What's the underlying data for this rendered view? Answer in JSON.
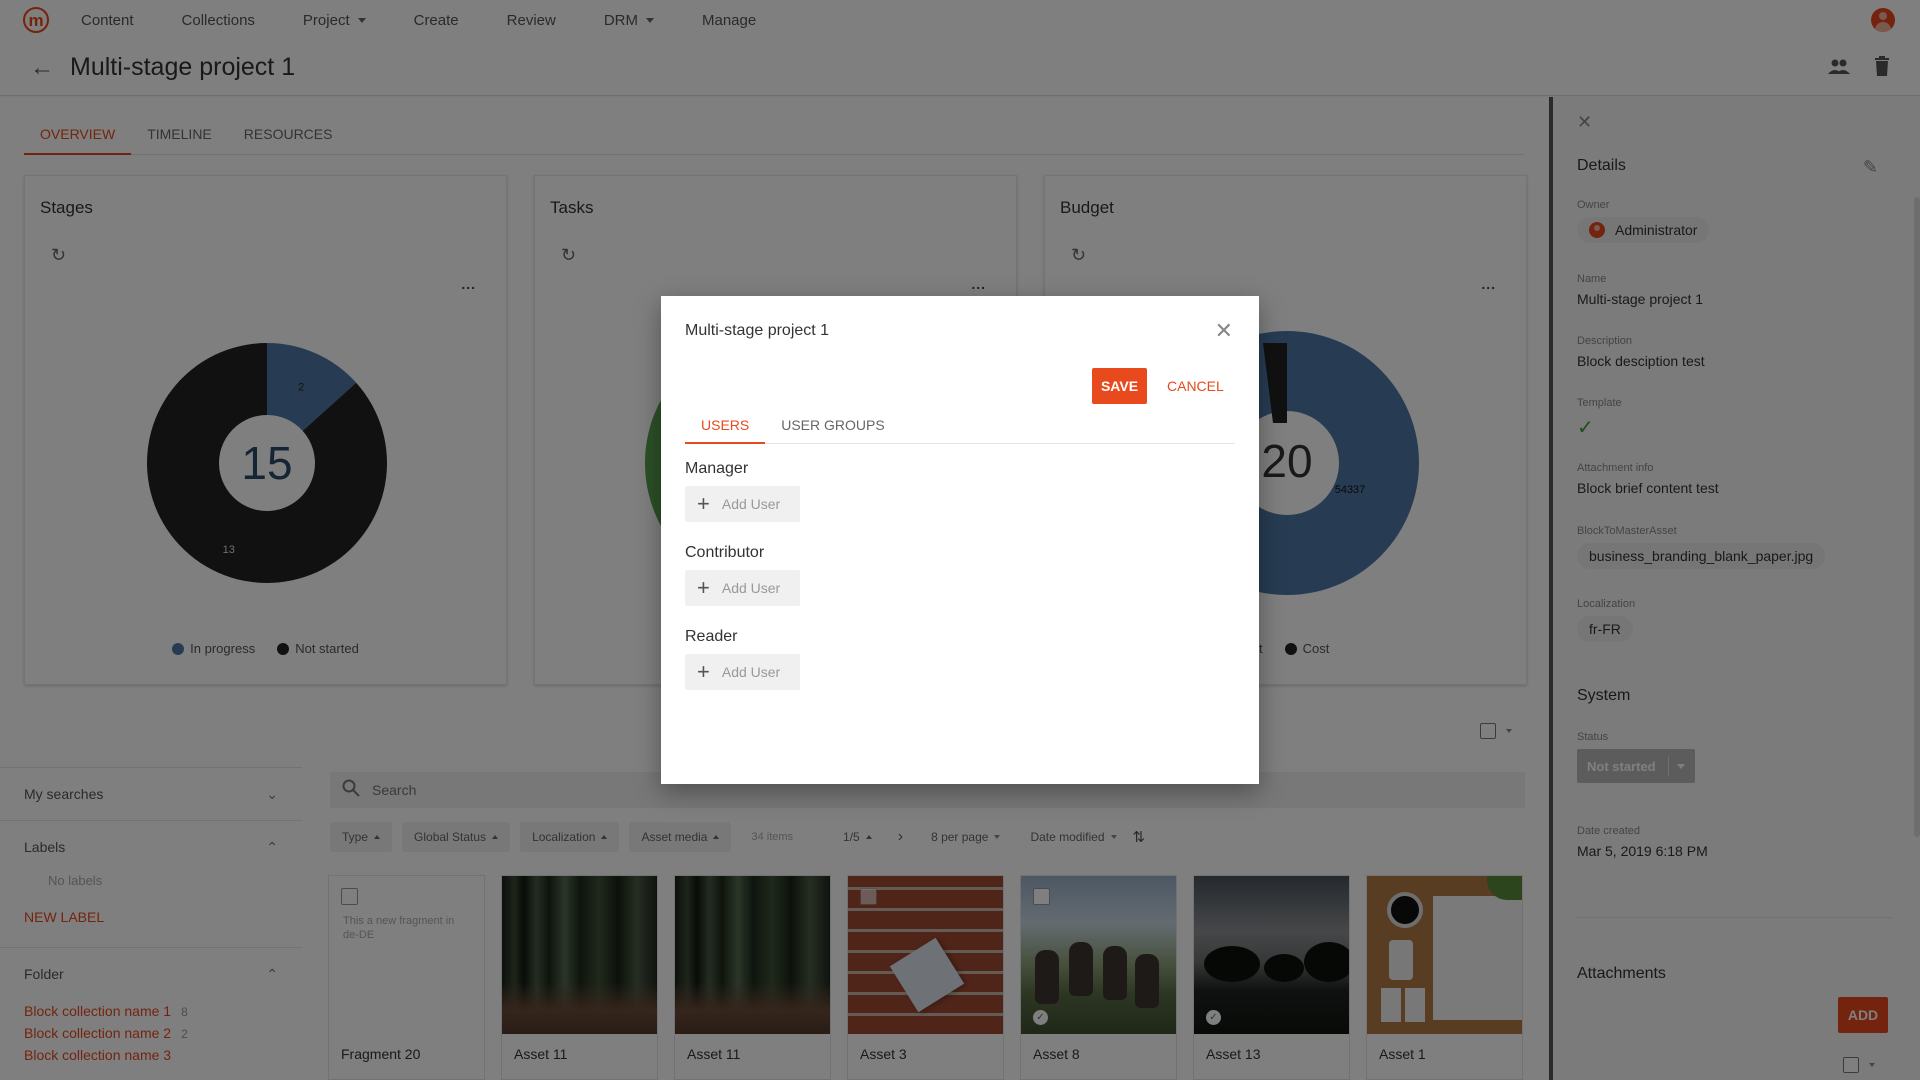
{
  "nav": {
    "logo": "m",
    "items": [
      {
        "label": "Content",
        "dropdown": false
      },
      {
        "label": "Collections",
        "dropdown": false
      },
      {
        "label": "Project",
        "dropdown": true
      },
      {
        "label": "Create",
        "dropdown": false
      },
      {
        "label": "Review",
        "dropdown": false
      },
      {
        "label": "DRM",
        "dropdown": true
      },
      {
        "label": "Manage",
        "dropdown": false
      }
    ]
  },
  "header": {
    "title": "Multi-stage project 1",
    "icons": [
      "back-arrow-icon",
      "people-icon",
      "trash-icon"
    ]
  },
  "tabs": [
    "OVERVIEW",
    "TIMELINE",
    "RESOURCES"
  ],
  "active_tab": "OVERVIEW",
  "cards": {
    "stages": {
      "title": "Stages",
      "total": "15",
      "more": "...",
      "legend": [
        "In progress",
        "Not started"
      ]
    },
    "tasks": {
      "title": "Tasks",
      "more": "..."
    },
    "budget": {
      "title": "Budget",
      "total_partial": "20",
      "label_partial": "54337",
      "more": "...",
      "legend": [
        "lget",
        "Cost"
      ]
    }
  },
  "chart_data": [
    {
      "type": "pie",
      "title": "Stages",
      "center_label": "15",
      "categories": [
        "In progress",
        "Not started"
      ],
      "values": [
        2,
        13
      ],
      "colors": [
        "#4e79a7",
        "#222222"
      ]
    }
  ],
  "colors": {
    "accent": "#e8491d",
    "in_progress": "#4e79a7",
    "not_started": "#222222",
    "budget": "#4e79a7",
    "tasks_green": "#59a14f"
  },
  "sidebar": {
    "my_searches": "My searches",
    "labels": "Labels",
    "no_labels": "No labels",
    "new_label": "NEW LABEL",
    "folder": "Folder",
    "folders": [
      {
        "name": "Block collection name 1",
        "count": "8"
      },
      {
        "name": "Block collection name 2",
        "count": "2"
      },
      {
        "name": "Block collection name 3",
        "count": ""
      }
    ]
  },
  "search": {
    "placeholder": "Search"
  },
  "filters": {
    "chips": [
      "Type",
      "Global Status",
      "Localization",
      "Asset media"
    ],
    "count": "34 items",
    "page": "1/5",
    "per_page": "8 per page",
    "sort": "Date modified"
  },
  "assets": [
    {
      "name": "Fragment 20",
      "text": "This a new fragment in de-DE",
      "kind": "fragment"
    },
    {
      "name": "Asset 11",
      "kind": "forest",
      "checked": false
    },
    {
      "name": "Asset 11",
      "kind": "forest",
      "checked": true
    },
    {
      "name": "Asset 3",
      "kind": "brick"
    },
    {
      "name": "Asset 8",
      "kind": "donkey",
      "checked": true
    },
    {
      "name": "Asset 13",
      "kind": "sunset",
      "checked": true
    },
    {
      "name": "Asset 1",
      "kind": "desk"
    }
  ],
  "details": {
    "title": "Details",
    "owner_label": "Owner",
    "owner": "Administrator",
    "name_label": "Name",
    "name": "Multi-stage project 1",
    "description_label": "Description",
    "description": "Block desciption test",
    "template_label": "Template",
    "attachment_info_label": "Attachment info",
    "attachment_info": "Block brief content test",
    "master_asset_label": "BlockToMasterAsset",
    "master_asset": "business_branding_blank_paper.jpg",
    "localization_label": "Localization",
    "localization": "fr-FR",
    "system_title": "System",
    "status_label": "Status",
    "status": "Not started",
    "date_created_label": "Date created",
    "date_created": "Mar 5, 2019 6:18 PM",
    "attachments_title": "Attachments",
    "add_label": "ADD"
  },
  "modal": {
    "title": "Multi-stage project 1",
    "save_label": "SAVE",
    "cancel_label": "CANCEL",
    "tabs": [
      "USERS",
      "USER GROUPS"
    ],
    "roles": [
      {
        "label": "Manager",
        "add_label": "Add User"
      },
      {
        "label": "Contributor",
        "add_label": "Add User"
      },
      {
        "label": "Reader",
        "add_label": "Add User"
      }
    ]
  }
}
